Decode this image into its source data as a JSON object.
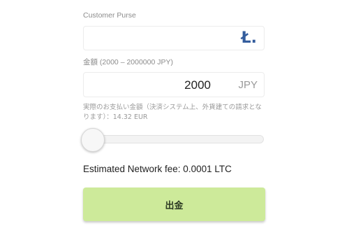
{
  "purse": {
    "label": "Customer Purse",
    "value": "",
    "placeholder": "",
    "icon": "litecoin-icon",
    "icon_glyph": "Ł.",
    "icon_color": "#345d9d"
  },
  "amount": {
    "label": "金額 (2000 – 2000000 JPY)",
    "value": "2000",
    "currency": "JPY"
  },
  "payment_note": "実際のお支払い金額（決済システム上、外貨建ての請求となります）：14.32 EUR",
  "slider": {
    "level": 0
  },
  "network_fee": "Estimated Network fee: 0.0001 LTC",
  "withdraw_button": {
    "label": "出金",
    "color": "#cdea9a"
  }
}
